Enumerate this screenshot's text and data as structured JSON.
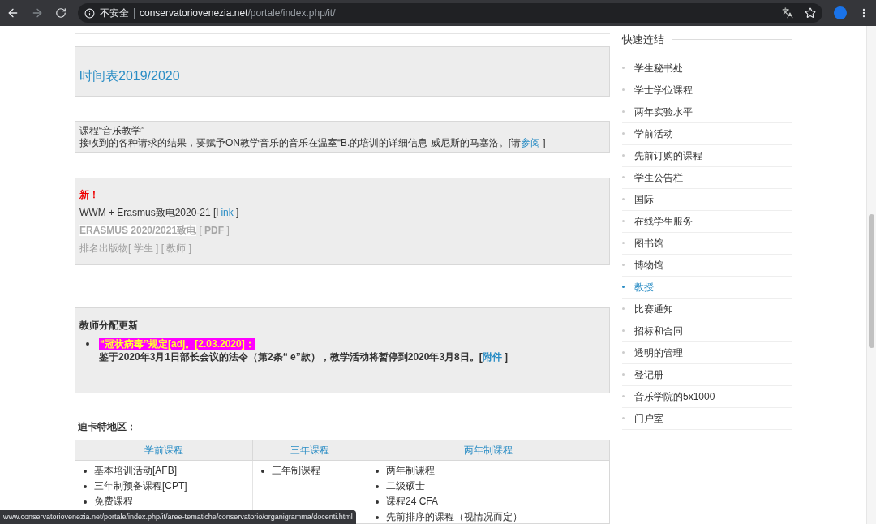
{
  "browser": {
    "security": "不安全",
    "host": "conservatoriovenezia.net",
    "path": "/portale/index.php/it/"
  },
  "boxes": [
    {
      "kind": "schedule",
      "lines": [
        {
          "kind": "link",
          "segments": [
            {
              "text": "时间表2019/2020",
              "link": true
            }
          ]
        }
      ]
    },
    {
      "kind": "course",
      "lines": [
        {
          "kind": "normal",
          "segments": [
            {
              "text": "课程“音乐教学”",
              "link": false
            }
          ]
        },
        {
          "kind": "normal",
          "segments": [
            {
              "text": "接收到的各种请求的结果，要赋予ON教学音乐的音乐在温室“B.的培训的详细信息 威尼斯的马塞洛。[请",
              "link": false
            },
            {
              "text": "参阅",
              "link": true
            },
            {
              "text": " ]",
              "link": false
            }
          ]
        }
      ]
    },
    {
      "kind": "news",
      "lines": [
        {
          "kind": "new",
          "segments": [
            {
              "text": "新！",
              "link": false
            }
          ]
        },
        {
          "kind": "normal",
          "segments": [
            {
              "text": "WWM + Erasmus致电2020-21 [l",
              "link": false
            },
            {
              "text": " ink",
              "link": true
            },
            {
              "text": " ]",
              "link": false
            }
          ]
        },
        {
          "kind": "muted",
          "segments": [
            {
              "text": "ERASMUS 2020/2021致电",
              "link": false
            },
            {
              "text": " [ ",
              "link": false
            },
            {
              "text": "PDF",
              "link": false
            },
            {
              "text": " ]",
              "link": false
            }
          ]
        },
        {
          "kind": "faint",
          "segments": [
            {
              "text": "排名出版物[ 学生 ] [ 教师 ]",
              "link": false
            }
          ]
        }
      ]
    },
    {
      "kind": "teachers",
      "title": "教师分配更新",
      "alert": "“冠状病毒”规定[adj。[2.03.2020]：",
      "lines": [
        {
          "kind": "bold",
          "segments": [
            {
              "text": "鉴于2020年3月1日部长会议的法令（第2条“ e”款），教学活动将暂停到2020年3月8日。[",
              "link": false
            },
            {
              "text": "附件",
              "link": true
            },
            {
              "text": " ]",
              "link": false
            }
          ]
        }
      ]
    }
  ],
  "section_title": "迪卡特地区：",
  "table": {
    "columns": [
      {
        "heading": "学前课程",
        "items": [
          "基本培训活动[AFB]",
          "三年制预备课程[CPT]",
          "免费课程"
        ]
      },
      {
        "heading": "三年课程",
        "items": [
          "三年制课程"
        ]
      },
      {
        "heading": "两年制课程",
        "items": [
          "两年制课程",
          "二级硕士",
          "课程24 CFA",
          "先前排序的课程（视情况而定）"
        ]
      }
    ]
  },
  "sidebar": {
    "title": "快速连结",
    "items": [
      {
        "label": "学生秘书处",
        "selected": false
      },
      {
        "label": "学士学位课程",
        "selected": false
      },
      {
        "label": "两年实验水平",
        "selected": false
      },
      {
        "label": "学前活动",
        "selected": false
      },
      {
        "label": "先前订购的课程",
        "selected": false
      },
      {
        "label": "学生公告栏",
        "selected": false
      },
      {
        "label": "国际",
        "selected": false
      },
      {
        "label": "在线学生服务",
        "selected": false
      },
      {
        "label": "图书馆",
        "selected": false
      },
      {
        "label": "博物馆",
        "selected": false
      },
      {
        "label": "教授",
        "selected": true
      },
      {
        "label": "比赛通知",
        "selected": false
      },
      {
        "label": "招标和合同",
        "selected": false
      },
      {
        "label": "透明的管理",
        "selected": false
      },
      {
        "label": "登记册",
        "selected": false
      },
      {
        "label": "音乐学院的5x1000",
        "selected": false
      },
      {
        "label": "门户室",
        "selected": false
      }
    ]
  },
  "status_url": "www.conservatoriovenezia.net/portale/index.php/it/aree-tematiche/conservatorio/organigramma/docenti.html"
}
